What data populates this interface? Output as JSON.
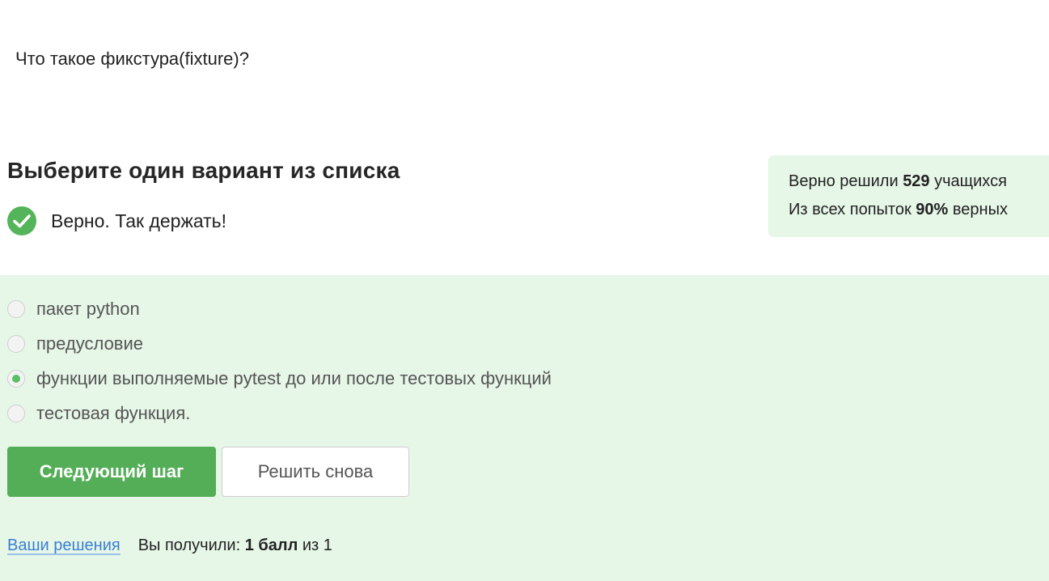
{
  "question": {
    "text": "Что такое фикстура(fixture)?"
  },
  "task": {
    "title": "Выберите один вариант из списка",
    "feedback": "Верно. Так держать!",
    "feedback_icon": "check-circle-icon"
  },
  "stats": {
    "line1_prefix": "Верно решили",
    "line1_value": "529",
    "line1_suffix": "учащихся",
    "line2_prefix": "Из всех попыток",
    "line2_value": "90%",
    "line2_suffix": "верных"
  },
  "options": [
    {
      "label": "пакет python",
      "selected": false
    },
    {
      "label": "предусловие",
      "selected": false
    },
    {
      "label": "функции выполняемые pytest до или после тестовых функций",
      "selected": true
    },
    {
      "label": "тестовая функция.",
      "selected": false
    }
  ],
  "buttons": {
    "next": "Следующий шаг",
    "retry": "Решить снова"
  },
  "footer": {
    "solutions_link": "Ваши решения",
    "score_prefix": "Вы получили:",
    "score_value": "1 балл",
    "score_suffix": "из 1"
  },
  "colors": {
    "accent_green": "#54ad57",
    "success_bg": "#e6f6e7",
    "link_blue": "#3b7fd4"
  }
}
